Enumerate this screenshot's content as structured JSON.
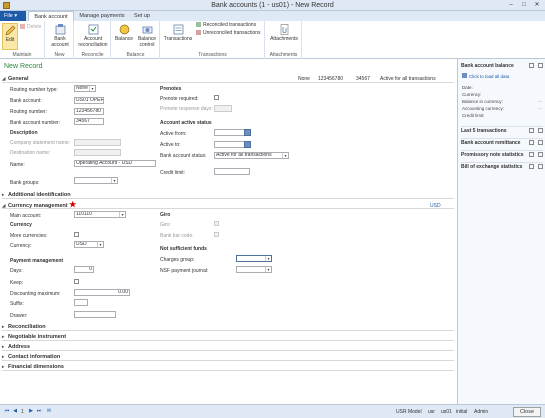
{
  "window": {
    "title": "Bank accounts (1 - us01) - New Record"
  },
  "tabs": {
    "file": "File",
    "bank_account": "Bank account",
    "manage_payments": "Manage payments",
    "setup": "Set up"
  },
  "ribbon": {
    "edit": "Edit",
    "delete": "Delete",
    "maintain": "Maintain",
    "bank_account": "Bank account",
    "new": "New",
    "account_reconciliation": "Account reconciliation",
    "reconcile": "Reconcile",
    "balance": "Balance",
    "balance_control": "Balance control",
    "balance_group": "Balance",
    "transactions": "Transactions",
    "reconciled_transactions": "Reconciled transactions",
    "unreconciled_transactions": "Unreconciled transactions",
    "transactions_group": "Transactions",
    "attachments": "Attachments",
    "attachments_group": "Attachments"
  },
  "record": {
    "new_record": "New Record",
    "top_none": "None",
    "top_account": "123456780",
    "top_number": "34567",
    "top_status": "Active for all transactions"
  },
  "general": {
    "header": "General",
    "routing_number_type_label": "Routing number type:",
    "routing_number_type": "None",
    "bank_account_label": "Bank account:",
    "bank_account": "US01 OPER",
    "routing_number_label": "Routing number:",
    "routing_number": "123456780",
    "bank_account_number_label": "Bank account number:",
    "bank_account_number": "34567",
    "description_header": "Description",
    "company_statement_name_label": "Company statement name:",
    "destination_name_label": "Destination name:",
    "name_label": "Name:",
    "name": "Operating Account - USD",
    "bank_groups_label": "Bank groups:",
    "prenotes_header": "Prenotes",
    "prenote_required_label": "Prenote required:",
    "prenote_response_days_label": "Prenote response days:",
    "active_status_header": "Account active status",
    "active_from_label": "Active from:",
    "active_to_label": "Active to:",
    "bank_account_status_label": "Bank account status:",
    "bank_account_status": "Active for all transactions",
    "credit_limit_label": "Credit limit:"
  },
  "sections": {
    "additional_identification": "Additional identification",
    "currency_management": "Currency management",
    "reconciliation": "Reconciliation",
    "negotiable_instrument": "Negotiable instrument",
    "address": "Address",
    "contact_information": "Contact information",
    "financial_dimensions": "Financial dimensions"
  },
  "currency": {
    "usd_badge": "USD",
    "main_account_label": "Main account:",
    "main_account": "110110",
    "currency_header": "Currency",
    "more_currencies_label": "More currencies:",
    "currency_label": "Currency:",
    "currency": "USD",
    "payment_management_header": "Payment management",
    "days_label": "Days:",
    "days": "0",
    "keep_label": "Keep:",
    "discounting_maximum_label": "Discounting maximum:",
    "discounting_maximum": "0.00",
    "suffix_label": "Suffix:",
    "drawer_label": "Drawer:",
    "giro_header": "Giro",
    "giro_label": "Giro:",
    "bank_bar_code_label": "Bank bar code:",
    "nsf_header": "Not sufficient funds",
    "charges_group_label": "Charges group:",
    "nsf_payment_journal_label": "NSF payment journal:"
  },
  "factbox": {
    "bank_account_balance": "Bank account balance",
    "click_to_load": "Click to load all data",
    "date_label": "Date:",
    "currency_label": "Currency:",
    "balance_in_currency_label": "Balance in currency:",
    "accounting_currency_label": "Accounting currency:",
    "credit_limit_label": "Credit limit:",
    "dashes": "---",
    "last5": "Last 5 transactions",
    "remittance": "Bank account remittance",
    "promissory": "Promissory note statistics",
    "boe": "Bill of exchange statistics"
  },
  "status": {
    "record": "1",
    "model": "USR Model",
    "user": "usr",
    "company": "us01",
    "layer": "initial",
    "admin": "Admin",
    "close": "Close"
  }
}
